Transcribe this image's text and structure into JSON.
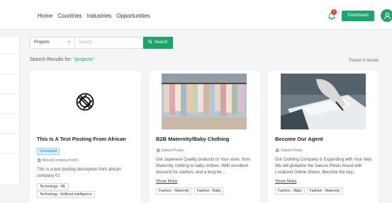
{
  "nav": {
    "home": "Home",
    "countries": "Countries",
    "industries": "Industries",
    "opportunities": "Opportunities"
  },
  "header": {
    "notification_count": "1",
    "dashboard_label": "Dashboard"
  },
  "search": {
    "category": "Projects",
    "placeholder": "Search",
    "button_label": "Search"
  },
  "results": {
    "prefix": "Search Results for:",
    "query": "\"projects\"",
    "count_text": "Found 3 results"
  },
  "cards": [
    {
      "title": "This Is A Test Posting From African",
      "badge": "Investment",
      "company": "AfricanCompanyTest01",
      "description": "This is a test posting description from african company 01",
      "tags": [
        "Technology - ML",
        "Technology - Artificial Intelligence"
      ]
    },
    {
      "title": "B2B Maternity/Baby Clothing",
      "company": "Sakura Petals",
      "description": "Get Japanese Quality products to Your store, from Maternity clothing to baby clothes. With excellent discount for starters, and a long ter...",
      "show_more": "Show More",
      "tags": [
        "Fashion - Maternity",
        "Fashion - Baby"
      ]
    },
    {
      "title": "Become Our Agent",
      "company": "Sakura Petals",
      "description": "Our Clothing Company is Expanding with Your help. We will globalize the Sakura Petals brand with Localized Online Stores. Become the key...",
      "show_more": "Show More",
      "tags": [
        "Fashion - Baby",
        "Fashion - Maternity"
      ]
    }
  ],
  "colors": {
    "accent": "#1ea36b",
    "notification": "#e53935"
  }
}
